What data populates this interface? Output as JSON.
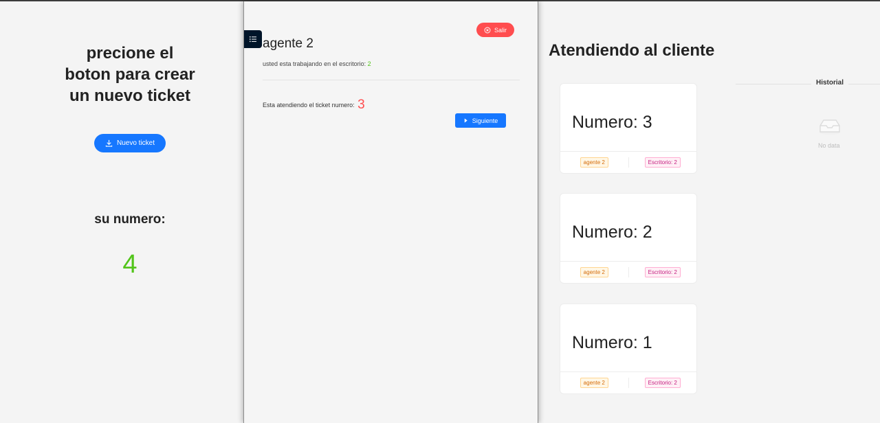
{
  "left": {
    "title": "precione el boton para crear un nuevo ticket",
    "new_button": "Nuevo ticket",
    "su_label": "su numero:",
    "su_value": "4"
  },
  "middle": {
    "logout": "Salir",
    "agent": "agente 2",
    "desk_prefix": "usted esta trabajando en el escritorio:",
    "desk_value": "2",
    "ticket_prefix": "Esta atendiendo el ticket numero:",
    "ticket_value": "3",
    "next_button": "Siguiente"
  },
  "right": {
    "title": "Atendiendo al cliente",
    "cards": [
      {
        "number": "Numero: 3",
        "agent": "agente 2",
        "desk": "Escritorio: 2"
      },
      {
        "number": "Numero: 2",
        "agent": "agente 2",
        "desk": "Escritorio: 2"
      },
      {
        "number": "Numero: 1",
        "agent": "agente 2",
        "desk": "Escritorio: 2"
      }
    ],
    "history_label": "Historial",
    "empty_text": "No data"
  },
  "colors": {
    "primary": "#1677ff",
    "danger": "#ff4d4f",
    "success": "#52c41a",
    "sider_dark": "#001529"
  },
  "icons": [
    "download-icon",
    "menu-list-icon",
    "close-circle-icon",
    "caret-right-icon",
    "empty-inbox-icon"
  ]
}
